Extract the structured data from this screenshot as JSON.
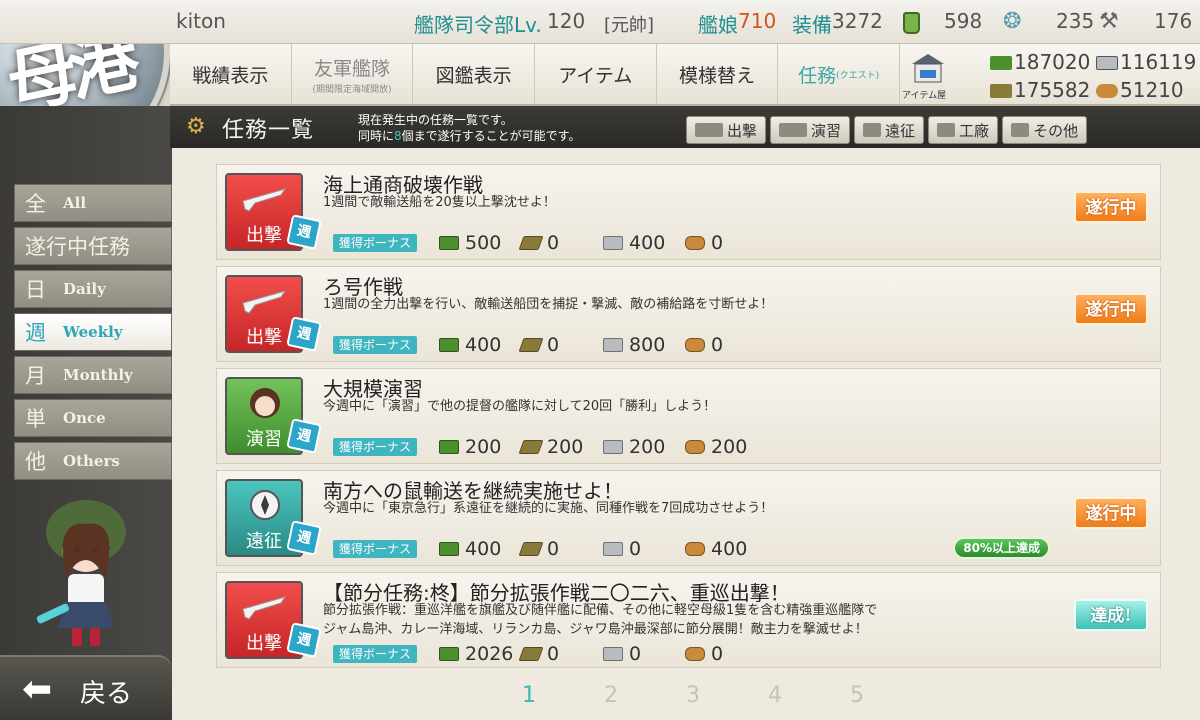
{
  "status": {
    "player_name": "kiton",
    "hq_label": "艦隊司令部Lv.",
    "hq_level": "120",
    "rank": "[元帥]",
    "ships_label": "艦娘",
    "ships_value": "710",
    "equip_label": "装備",
    "equip_value": "3272",
    "fuel_buckets": "598",
    "buckets": "235",
    "dev_materials": "176"
  },
  "nav": {
    "items": [
      {
        "label": "戦績表示"
      },
      {
        "label": "友軍艦隊",
        "sub": "(期間限定海域開放)"
      },
      {
        "label": "図鑑表示"
      },
      {
        "label": "アイテム"
      },
      {
        "label": "模様替え"
      },
      {
        "label": "任務",
        "small": "(クエスト)"
      }
    ],
    "shop_label": "アイテム屋"
  },
  "resources": {
    "fuel": "187020",
    "steel": "116119",
    "ammo": "175582",
    "bauxite": "51210"
  },
  "header": {
    "title": "任務一覧",
    "desc_line1": "現在発生中の任務一覧です。",
    "desc_line2_a": "同時に",
    "desc_line2_num": "8",
    "desc_line2_b": "個まで遂行することが可能です。",
    "filters": [
      "出撃",
      "演習",
      "遠征",
      "工廠",
      "その他"
    ]
  },
  "sidebar": {
    "items": [
      {
        "kanji": "全",
        "en": "All"
      },
      {
        "kanji": "遂行中任務",
        "en": ""
      },
      {
        "kanji": "日",
        "en": "Daily"
      },
      {
        "kanji": "週",
        "en": "Weekly"
      },
      {
        "kanji": "月",
        "en": "Monthly"
      },
      {
        "kanji": "単",
        "en": "Once"
      },
      {
        "kanji": "他",
        "en": "Others"
      }
    ],
    "back_label": "戻る"
  },
  "quests": [
    {
      "category": "出撃",
      "period": "週",
      "title": "海上通商破壊作戦",
      "desc1": "1週間で敵輸送船を20隻以上撃沈せよ！",
      "desc2": "",
      "bonus_label": "獲得ボーナス",
      "fuel": "500",
      "ammo": "0",
      "steel": "400",
      "baux": "0",
      "status": "遂行中",
      "progress": ""
    },
    {
      "category": "出撃",
      "period": "週",
      "title": "ろ号作戦",
      "desc1": "1週間の全力出撃を行い、敵輸送船団を捕捉・撃滅、敵の補給路を寸断せよ！",
      "desc2": "",
      "bonus_label": "獲得ボーナス",
      "fuel": "400",
      "ammo": "0",
      "steel": "800",
      "baux": "0",
      "status": "遂行中",
      "progress": ""
    },
    {
      "category": "演習",
      "period": "週",
      "title": "大規模演習",
      "desc1": "今週中に「演習」で他の提督の艦隊に対して20回「勝利」しよう！",
      "desc2": "",
      "bonus_label": "獲得ボーナス",
      "fuel": "200",
      "ammo": "200",
      "steel": "200",
      "baux": "200",
      "status": "",
      "progress": ""
    },
    {
      "category": "遠征",
      "period": "週",
      "title": "南方への鼠輸送を継続実施せよ！",
      "desc1": "今週中に「東京急行」系遠征を継続的に実施、同種作戦を7回成功させよう！",
      "desc2": "",
      "bonus_label": "獲得ボーナス",
      "fuel": "400",
      "ammo": "0",
      "steel": "0",
      "baux": "400",
      "status": "遂行中",
      "progress": "80%以上達成"
    },
    {
      "category": "出撃",
      "period": "週",
      "title": "【節分任務:柊】節分拡張作戦二〇二六、重巡出撃！",
      "desc1": "節分拡張作戦：重巡洋艦を旗艦及び随伴艦に配備、その他に軽空母級1隻を含む精強重巡艦隊で",
      "desc2": "ジャム島沖、カレー洋海域、リランカ島、ジャワ島沖最深部に節分展開！敵主力を撃滅せよ！",
      "bonus_label": "獲得ボーナス",
      "fuel": "2026",
      "ammo": "0",
      "steel": "0",
      "baux": "0",
      "status": "達成!",
      "progress": ""
    }
  ],
  "pager": [
    "1",
    "2",
    "3",
    "4",
    "5"
  ],
  "colors": {
    "accent": "#3aa8a5",
    "sortie": "#e03434",
    "exercise": "#5aa845",
    "expedition": "#3bb2ac",
    "ongoing": "#f28a24",
    "done": "#4cc8bb"
  }
}
